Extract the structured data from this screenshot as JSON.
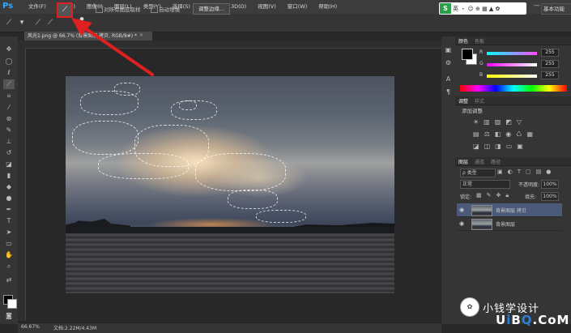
{
  "app": {
    "logo": "Ps",
    "menus": [
      "文件(F)",
      "编辑(E)",
      "图像(I)",
      "图层(L)",
      "类型(Y)",
      "选择(S)",
      "滤镜(T)",
      "3D(D)",
      "视图(V)",
      "窗口(W)",
      "帮助(H)"
    ],
    "window_controls": [
      "—",
      "□",
      "✕"
    ]
  },
  "options_bar": {
    "brush_size": "15",
    "sample_all_layers": "对所有图层取样",
    "auto_enhance": "自动增强",
    "refine_edge": "调整边缘...",
    "ime_text": "英 ・ ☺ ⊕ ▦ ▲ ✿",
    "ime_logo": "S",
    "workspace": "基本功能"
  },
  "document": {
    "tab_title": "风光1.png @ 66.7% (背景图层 拷贝, RGB/8#) *",
    "close": "×"
  },
  "color_panel": {
    "tabs": [
      "颜色",
      "色板"
    ],
    "r_label": "R",
    "g_label": "G",
    "b_label": "B",
    "r_value": "255",
    "g_value": "255",
    "b_value": "255",
    "colors": {
      "r": "#ff4a4a",
      "g": "#4aff4a",
      "b": "#4a4aff"
    }
  },
  "adjust_panel": {
    "tabs": [
      "调整",
      "样式"
    ],
    "label": "添加调整"
  },
  "layers_panel": {
    "tabs": [
      "图层",
      "通道",
      "路径"
    ],
    "filter": "ρ 类型",
    "blend_mode": "正常",
    "opacity_label": "不透明度:",
    "opacity_value": "100%",
    "lock_label": "锁定:",
    "fill_label": "填充:",
    "fill_value": "100%",
    "layers": [
      {
        "name": "背景图层 拷贝",
        "selected": true
      },
      {
        "name": "背景图层",
        "selected": false
      }
    ]
  },
  "status": {
    "zoom": "66.67%",
    "doc_info": "文档:2.22M/4.43M"
  },
  "watermark": {
    "wechat_name": "小钱学设计",
    "site_u": "U",
    "site_i": "i",
    "site_b": "B",
    "site_q": "Q",
    "site_rest": ".CoM"
  }
}
